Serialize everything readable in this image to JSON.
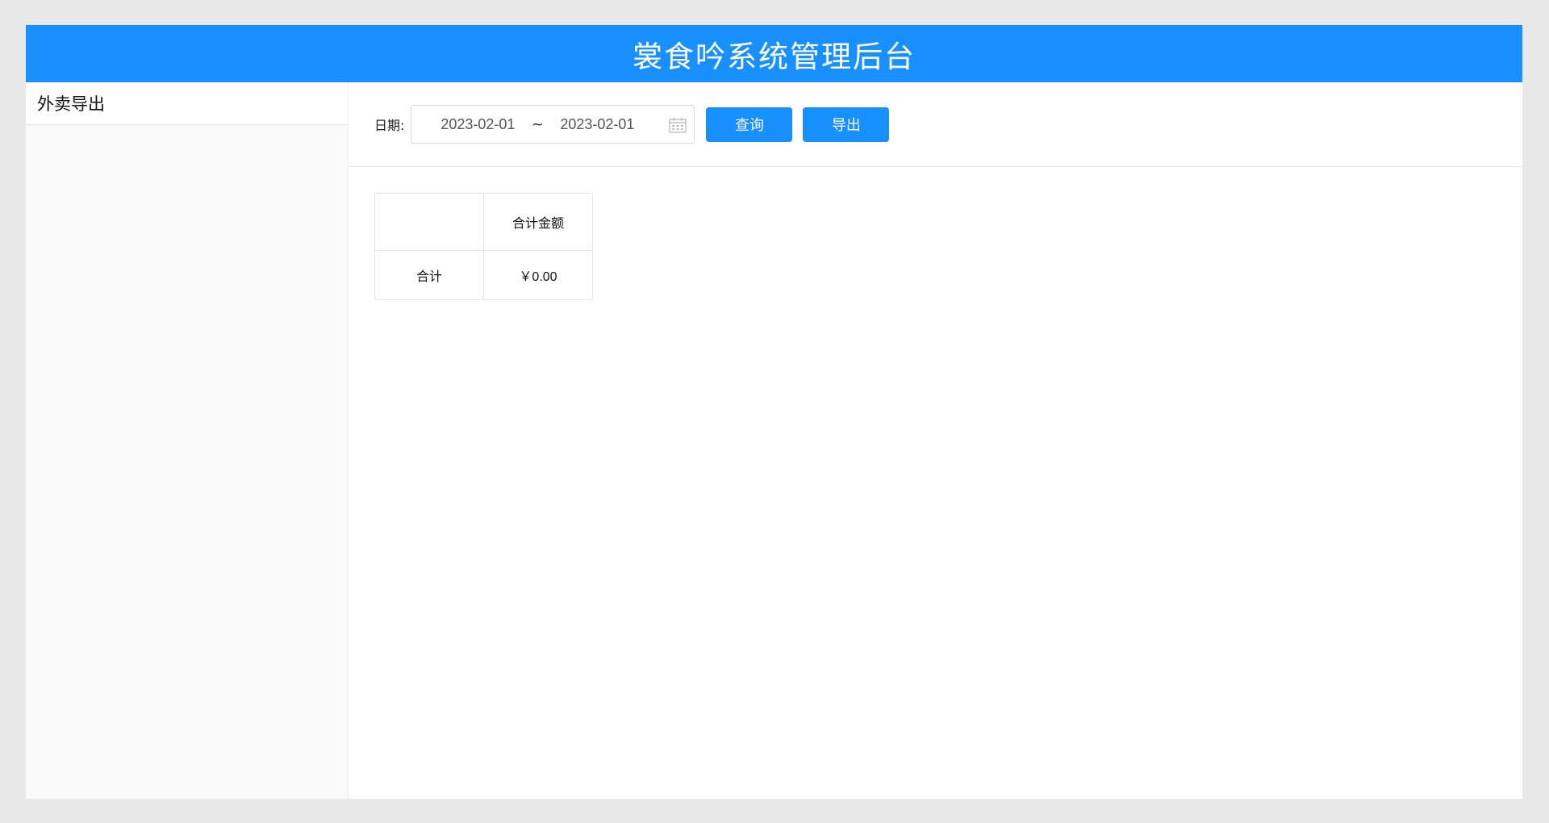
{
  "header": {
    "title": "裳食吟系统管理后台"
  },
  "sidebar": {
    "items": [
      {
        "label": "外卖导出",
        "icon": "none"
      }
    ]
  },
  "toolbar": {
    "date_label": "日期:",
    "start_date": "2023-02-01",
    "separator": "~",
    "end_date": "2023-02-01",
    "calendar_icon": "calendar-icon",
    "query_label": "查询",
    "export_label": "导出"
  },
  "summary_table": {
    "headers": [
      "",
      "合计金额"
    ],
    "rows": [
      [
        "合计",
        "￥0.00"
      ]
    ]
  },
  "colors": {
    "primary": "#1890ff",
    "background": "#e8e8e8",
    "sidebar_bg": "#fafafa"
  }
}
